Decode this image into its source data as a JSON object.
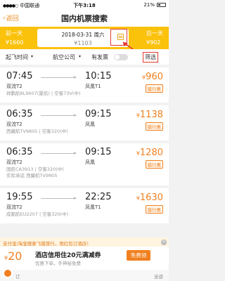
{
  "status_bar": {
    "carrier": "中国联通",
    "time": "下午3:18",
    "battery": "21%"
  },
  "nav": {
    "back_label": "返回",
    "title": "国内机票搜索"
  },
  "date_bar": {
    "prev": {
      "label": "前一天",
      "price": "¥1660"
    },
    "current": {
      "date": "2018-03-31 周六",
      "price": "¥1103"
    },
    "next": {
      "label": "后一天",
      "price": "¥902"
    }
  },
  "filters": {
    "depart": "起飞时间",
    "airline": "航空公司",
    "direct": "有发票",
    "filter": "筛选"
  },
  "flights": [
    {
      "dep_time": "07:45",
      "arr_time": "10:15",
      "from": "双流T2",
      "to": "凤凰T1",
      "info": "祥鹏航8L9607(厦航) | 空客73V(中)",
      "price": "960",
      "badge": "猎行惠"
    },
    {
      "dep_time": "06:35",
      "arr_time": "09:15",
      "from": "双流T2",
      "to": "凤凰",
      "info": "西藏航TV9805 | 空客320(中)",
      "price": "1138",
      "badge": "猎行惠"
    },
    {
      "dep_time": "06:35",
      "arr_time": "09:15",
      "from": "双流T2",
      "to": "凤凰",
      "info": "国航CA3913 | 空客320(中)",
      "info2": "实际承运 西藏航TV9805",
      "price": "1280",
      "badge": "猎行惠"
    },
    {
      "dep_time": "19:55",
      "arr_time": "22:25",
      "from": "双流T2",
      "to": "凤凰T1",
      "info": "成都航EU2207 | 空客320(中)",
      "price": "1630",
      "badge": "猎行惠"
    }
  ],
  "ad": {
    "top_text": "支付宝/淘宝搜索飞猪旅行，用红包订酒店！",
    "amount": "20",
    "message": "酒店信用住20元满减券",
    "sub": "优惠下单，手神秘免费",
    "claim": "免费领",
    "foot_left": "订",
    "foot_right": "足迹"
  }
}
